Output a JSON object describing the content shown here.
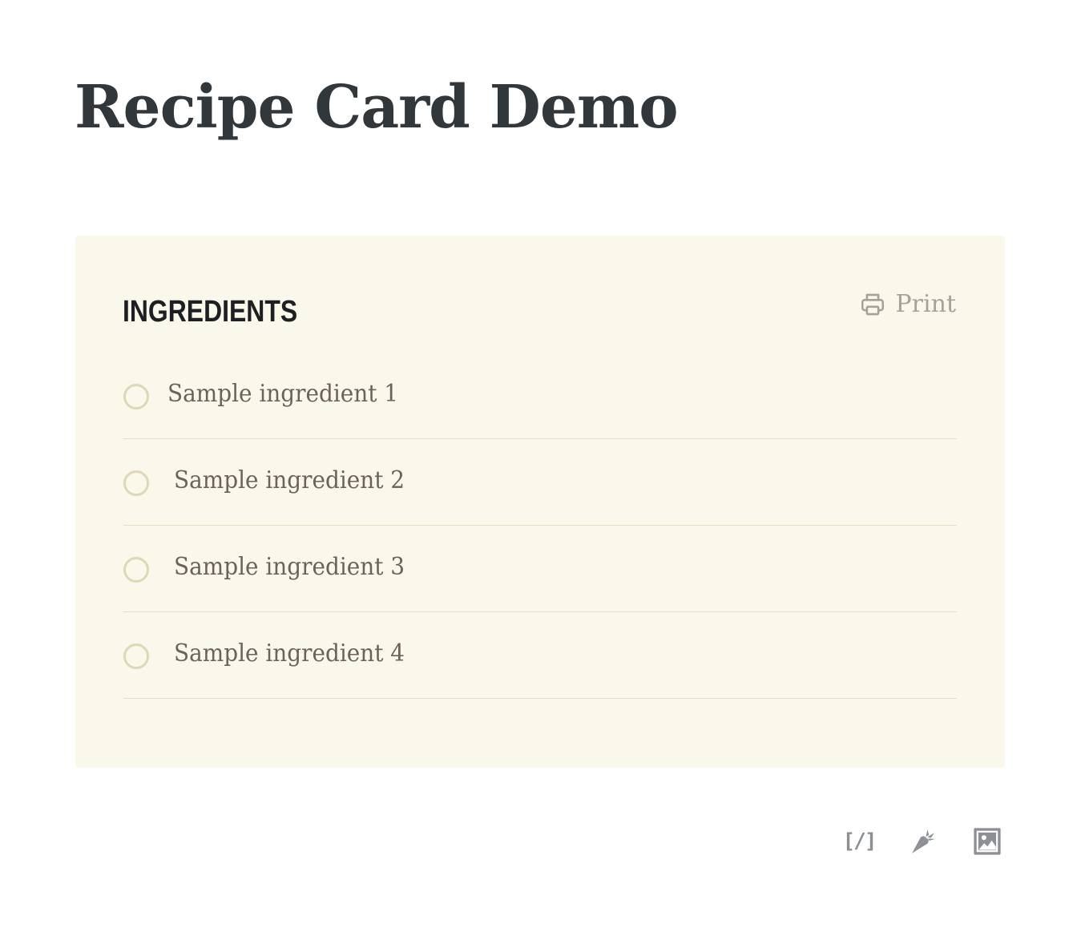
{
  "page": {
    "title": "Recipe Card Demo"
  },
  "card": {
    "background_color": "#f9f8ea",
    "section_heading": "INGREDIENTS",
    "print_label": "Print",
    "print_icon": "printer-icon",
    "ingredients": [
      {
        "label": "Sample ingredient 1",
        "checked": false
      },
      {
        "label": "Sample ingredient 2",
        "checked": false
      },
      {
        "label": "Sample ingredient 3",
        "checked": false
      },
      {
        "label": "Sample ingredient 4",
        "checked": false
      }
    ]
  },
  "toolbar": {
    "shortcode_text": "[/]",
    "icons": [
      "shortcode-icon",
      "carrot-icon",
      "image-icon"
    ]
  }
}
